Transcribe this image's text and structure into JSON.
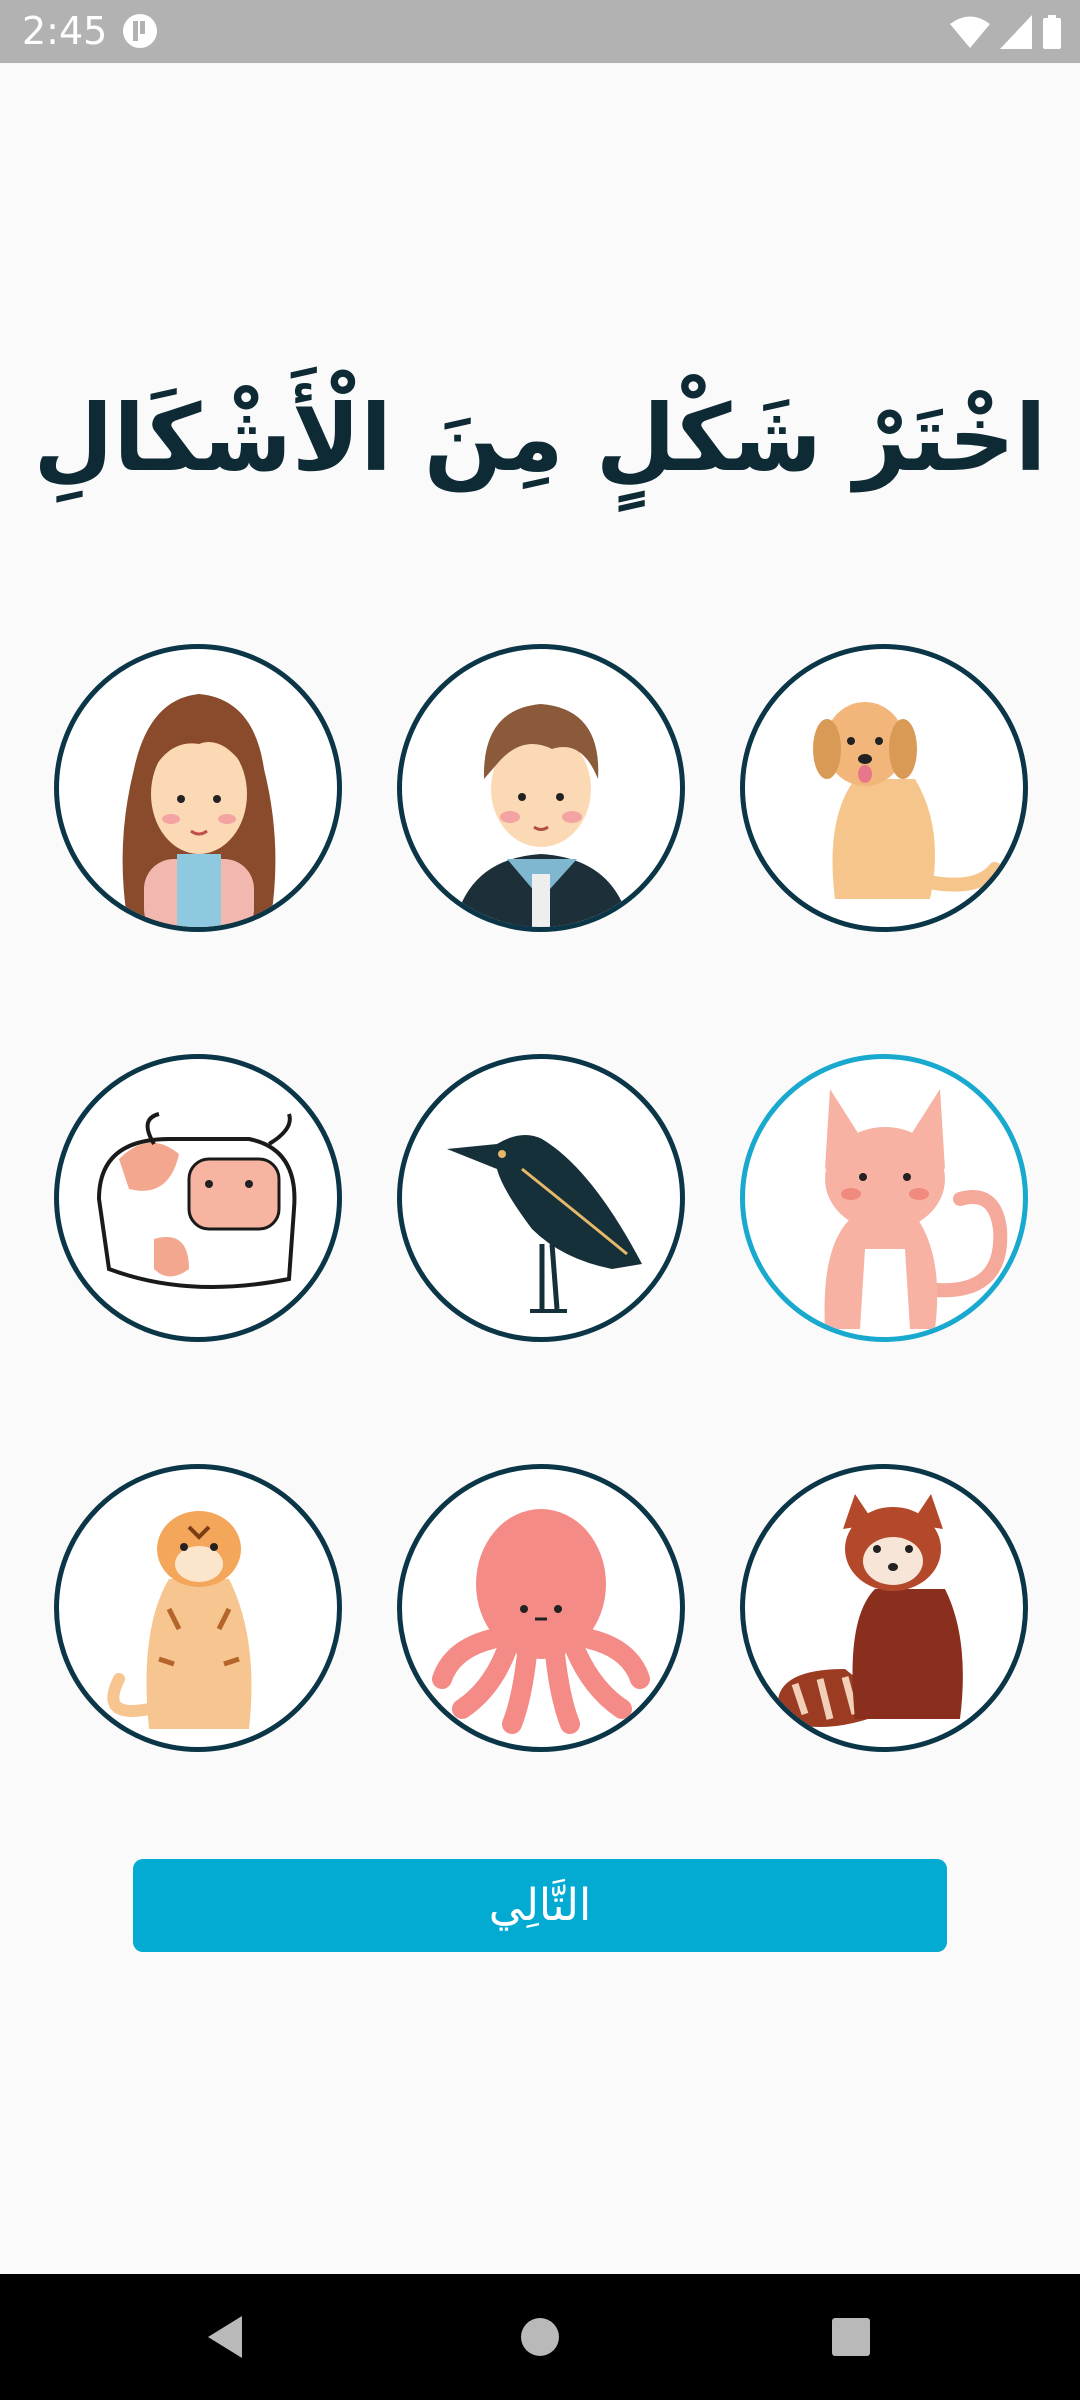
{
  "status_bar": {
    "time": "2:45"
  },
  "title": "اخْتَرْ شَكْلٍ مِنَ الْأَشْكَالِ",
  "avatars": [
    {
      "icon": "girl-avatar-icon",
      "selected": false
    },
    {
      "icon": "boy-avatar-icon",
      "selected": false
    },
    {
      "icon": "dog-avatar-icon",
      "selected": false
    },
    {
      "icon": "cow-avatar-icon",
      "selected": false
    },
    {
      "icon": "crow-avatar-icon",
      "selected": false
    },
    {
      "icon": "cat-avatar-icon",
      "selected": true
    },
    {
      "icon": "tiger-avatar-icon",
      "selected": false
    },
    {
      "icon": "octopus-avatar-icon",
      "selected": false
    },
    {
      "icon": "red-panda-avatar-icon",
      "selected": false
    }
  ],
  "next_button": {
    "label": "التَّالِي"
  },
  "colors": {
    "accent": "#03abd3",
    "title": "#0d2a35",
    "ring": "#0b3647",
    "selected_ring": "#19a9cf"
  }
}
